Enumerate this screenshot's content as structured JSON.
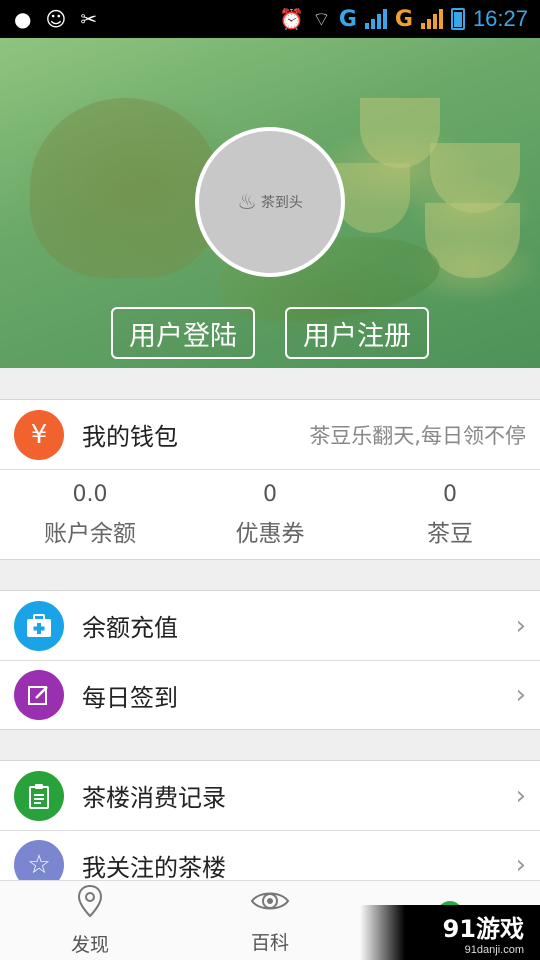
{
  "status_bar": {
    "time": "16:27",
    "network_1": "G",
    "network_2": "G"
  },
  "header": {
    "avatar_logo_text": "茶到头",
    "login_label": "用户登陆",
    "register_label": "用户注册"
  },
  "wallet": {
    "title": "我的钱包",
    "tagline": "茶豆乐翻天,每日领不停",
    "icon": "yen-icon",
    "stats": [
      {
        "value": "0.0",
        "label": "账户余额"
      },
      {
        "value": "0",
        "label": "优惠券"
      },
      {
        "value": "0",
        "label": "茶豆"
      }
    ]
  },
  "services": [
    {
      "label": "余额充值",
      "icon": "medkit-icon",
      "color": "#1aa3e6"
    },
    {
      "label": "每日签到",
      "icon": "edit-icon",
      "color": "#9a2fb0"
    }
  ],
  "records": [
    {
      "label": "茶楼消费记录",
      "icon": "clipboard-icon",
      "color": "#2aa23c"
    },
    {
      "label": "我关注的茶楼",
      "icon": "star-icon",
      "color": "#7a86d0"
    }
  ],
  "bottom_nav": [
    {
      "label": "发现",
      "icon": "location-pin-icon"
    },
    {
      "label": "百科",
      "icon": "eye-icon"
    },
    {
      "label": "",
      "icon": "profile-icon"
    }
  ],
  "watermark": {
    "title": "91游戏",
    "subtitle": "91danji.com"
  },
  "colors": {
    "wallet_icon": "#f2622e",
    "active_nav": "#28a94a"
  }
}
